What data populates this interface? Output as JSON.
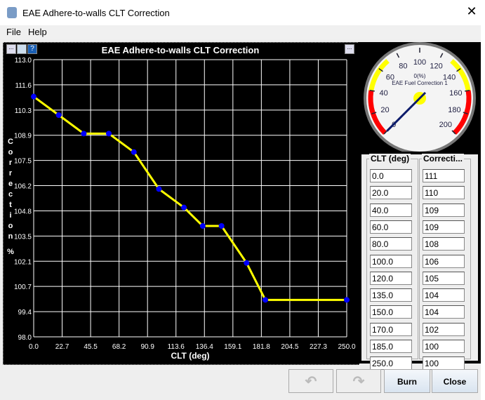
{
  "window": {
    "title": "EAE Adhere-to-walls CLT Correction",
    "close_glyph": "✕"
  },
  "menu": [
    "File",
    "Help"
  ],
  "chart_data": {
    "type": "line",
    "title": "EAE Adhere-to-walls CLT Correction",
    "xlabel": "CLT (deg)",
    "ylabel": "Correction %",
    "xlim": [
      0,
      250
    ],
    "ylim": [
      98,
      113
    ],
    "xticks": [
      "0.0",
      "22.7",
      "45.5",
      "68.2",
      "90.9",
      "113.6",
      "136.4",
      "159.1",
      "181.8",
      "204.5",
      "227.3",
      "250.0"
    ],
    "yticks": [
      "113.0",
      "111.6",
      "110.3",
      "108.9",
      "107.5",
      "106.2",
      "104.8",
      "103.5",
      "102.1",
      "100.7",
      "99.4",
      "98.0"
    ],
    "x": [
      0,
      20,
      40,
      60,
      80,
      100,
      120,
      135,
      150,
      170,
      185,
      250
    ],
    "y": [
      111,
      110,
      109,
      109,
      108,
      106,
      105,
      104,
      104,
      102,
      100,
      100
    ],
    "line_color": "#ffff00",
    "point_color": "#0000ff"
  },
  "gauge": {
    "title": "EAE Fuel Correction 1",
    "value_text": "0(%)",
    "value": 0,
    "min": 0,
    "max": 200,
    "labels": [
      "0",
      "20",
      "40",
      "60",
      "80",
      "100",
      "120",
      "140",
      "160",
      "180",
      "200"
    ]
  },
  "table": {
    "headers": [
      "CLT (deg)",
      "Correcti..."
    ],
    "clt": [
      "0.0",
      "20.0",
      "40.0",
      "60.0",
      "80.0",
      "100.0",
      "120.0",
      "135.0",
      "150.0",
      "170.0",
      "185.0",
      "250.0"
    ],
    "corr": [
      "111",
      "110",
      "109",
      "109",
      "108",
      "106",
      "105",
      "104",
      "104",
      "102",
      "100",
      "100"
    ]
  },
  "buttons": {
    "undo": "↶",
    "redo": "↷",
    "burn": "Burn",
    "close": "Close"
  }
}
